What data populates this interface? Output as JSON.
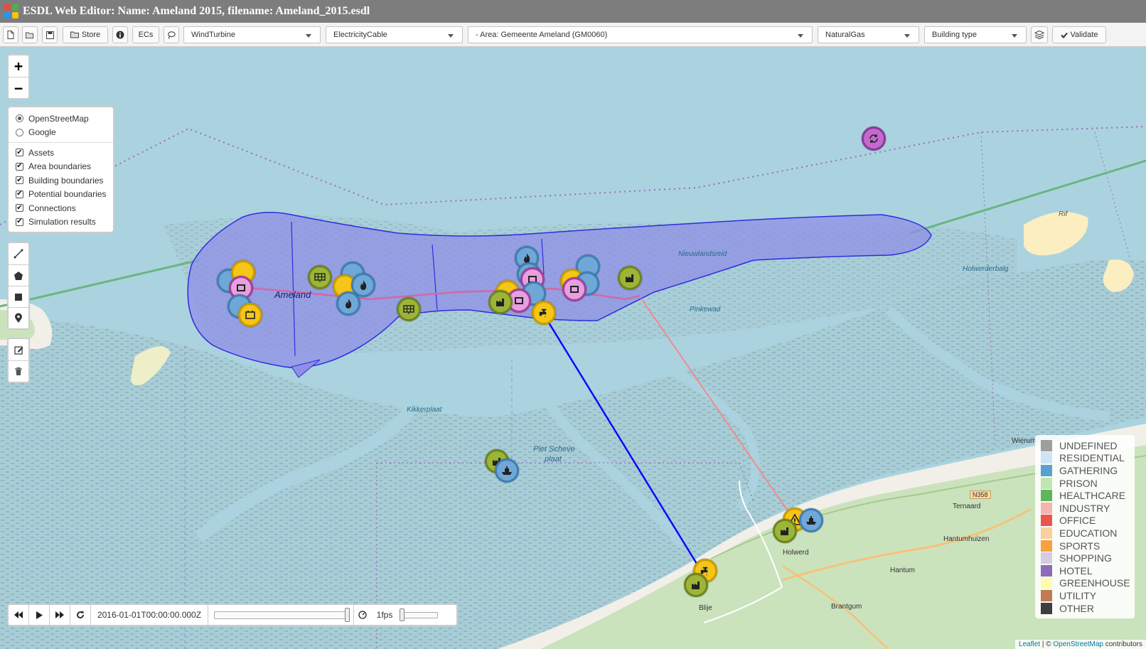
{
  "window": {
    "title": "ESDL Web Editor: Name: Ameland 2015, filename: Ameland_2015.esdl"
  },
  "toolbar": {
    "store_label": "Store",
    "ecs_label": "ECs",
    "validate_label": "Validate",
    "selects": {
      "asset": "WindTurbine",
      "cable": "ElectricityCable",
      "area": "- Area: Gemeente Ameland (GM0060)",
      "carrier": "NaturalGas",
      "building_type": "Building type"
    }
  },
  "layers": {
    "base_layers": [
      {
        "label": "OpenStreetMap",
        "selected": true
      },
      {
        "label": "Google",
        "selected": false
      }
    ],
    "overlays": [
      {
        "label": "Assets",
        "checked": true
      },
      {
        "label": "Area boundaries",
        "checked": true
      },
      {
        "label": "Building boundaries",
        "checked": true
      },
      {
        "label": "Potential boundaries",
        "checked": true
      },
      {
        "label": "Connections",
        "checked": true
      },
      {
        "label": "Simulation results",
        "checked": true
      }
    ]
  },
  "map_labels": {
    "ameland": "Ameland",
    "nieuwlandsreid": "Nieuwlandsreid",
    "pinkewad": "Pinkewad",
    "holwerderbalg": "Holwerderbalg",
    "rif": "Rif",
    "kikkerplaat": "Kikkerplaat",
    "piet_scheve": "Piet Scheve",
    "plaat": "plaat",
    "holwerd": "Holwerd",
    "blije": "Blije",
    "ternaard": "Ternaard",
    "hantumhuizen": "Hantumhuizen",
    "hantum": "Hantum",
    "brantgum": "Brantgum",
    "wierum": "Wierum",
    "road": "N358"
  },
  "legend": {
    "items": [
      {
        "label": "UNDEFINED",
        "color": "#9e9e9e"
      },
      {
        "label": "RESIDENTIAL",
        "color": "#cfe3f2"
      },
      {
        "label": "GATHERING",
        "color": "#5a9fd1"
      },
      {
        "label": "PRISON",
        "color": "#bfe6b0"
      },
      {
        "label": "HEALTHCARE",
        "color": "#5fb55a"
      },
      {
        "label": "INDUSTRY",
        "color": "#f7b3b0"
      },
      {
        "label": "OFFICE",
        "color": "#e8564d"
      },
      {
        "label": "EDUCATION",
        "color": "#fbcf9e"
      },
      {
        "label": "SPORTS",
        "color": "#f7a13f"
      },
      {
        "label": "SHOPPING",
        "color": "#d6cbe3"
      },
      {
        "label": "HOTEL",
        "color": "#8e6bb8"
      },
      {
        "label": "GREENHOUSE",
        "color": "#fdfcb0"
      },
      {
        "label": "UTILITY",
        "color": "#c27a53"
      },
      {
        "label": "OTHER",
        "color": "#3e3e3e"
      }
    ]
  },
  "timeline": {
    "timestamp": "2016-01-01T00:00:00.000Z",
    "fps": "1fps"
  },
  "attribution": {
    "leaflet": "Leaflet",
    "sep": " | © ",
    "osm": "OpenStreetMap",
    "suffix": " contributors"
  }
}
